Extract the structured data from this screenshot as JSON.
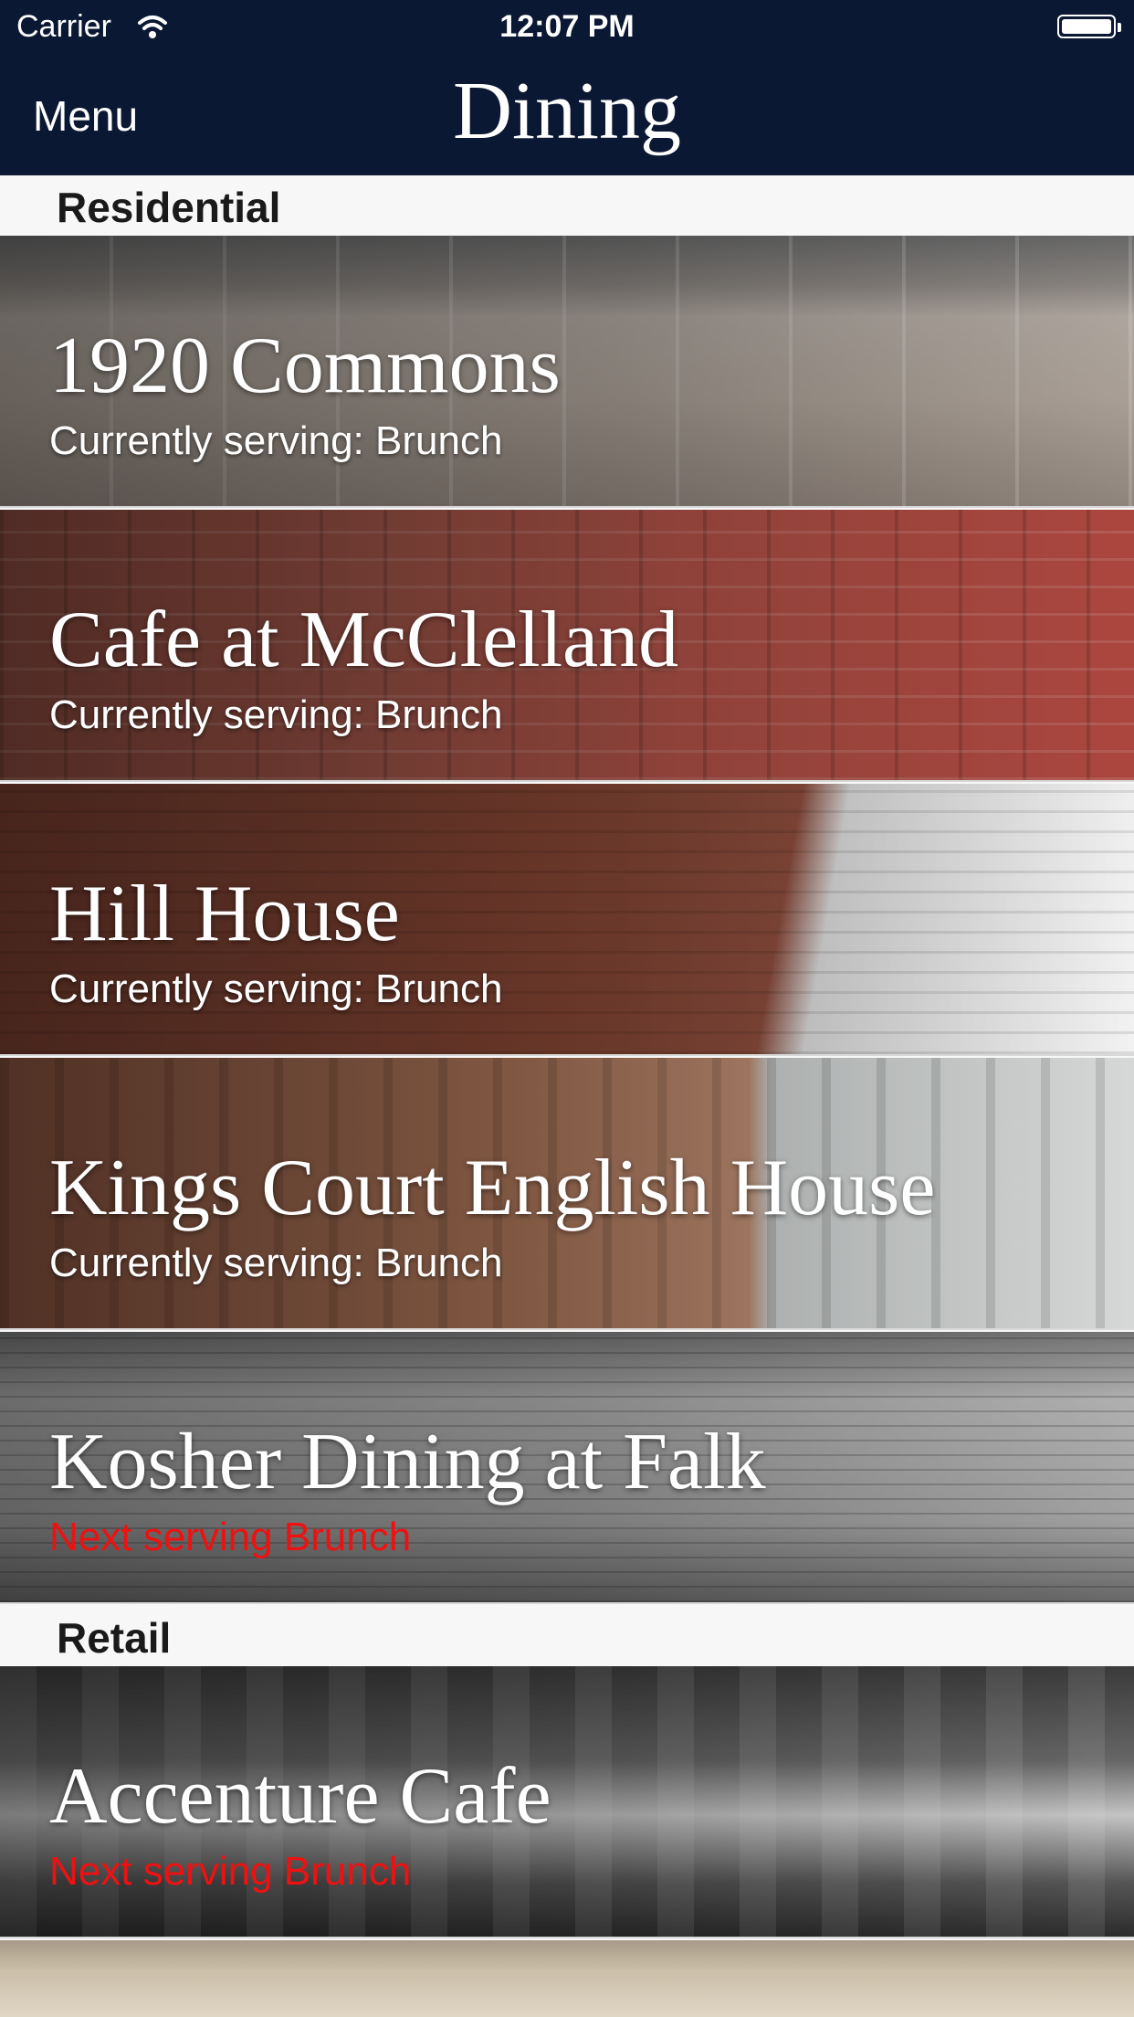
{
  "status_bar": {
    "carrier": "Carrier",
    "time": "12:07 PM"
  },
  "nav": {
    "menu_label": "Menu",
    "title": "Dining"
  },
  "sections": [
    {
      "header": "Residential",
      "items": [
        {
          "name": "1920 Commons",
          "status": "Currently serving: Brunch",
          "open": true
        },
        {
          "name": "Cafe at McClelland",
          "status": "Currently serving: Brunch",
          "open": true
        },
        {
          "name": "Hill House",
          "status": "Currently serving: Brunch",
          "open": true
        },
        {
          "name": "Kings Court English House",
          "status": "Currently serving: Brunch",
          "open": true
        },
        {
          "name": "Kosher Dining at Falk",
          "status": "Next serving Brunch",
          "open": false
        }
      ]
    },
    {
      "header": "Retail",
      "items": [
        {
          "name": "Accenture Cafe",
          "status": "Next serving Brunch",
          "open": false
        }
      ]
    }
  ],
  "colors": {
    "nav_background": "#0b1833",
    "closed_status": "#ee1111",
    "section_header_bg": "#f7f7f7"
  }
}
